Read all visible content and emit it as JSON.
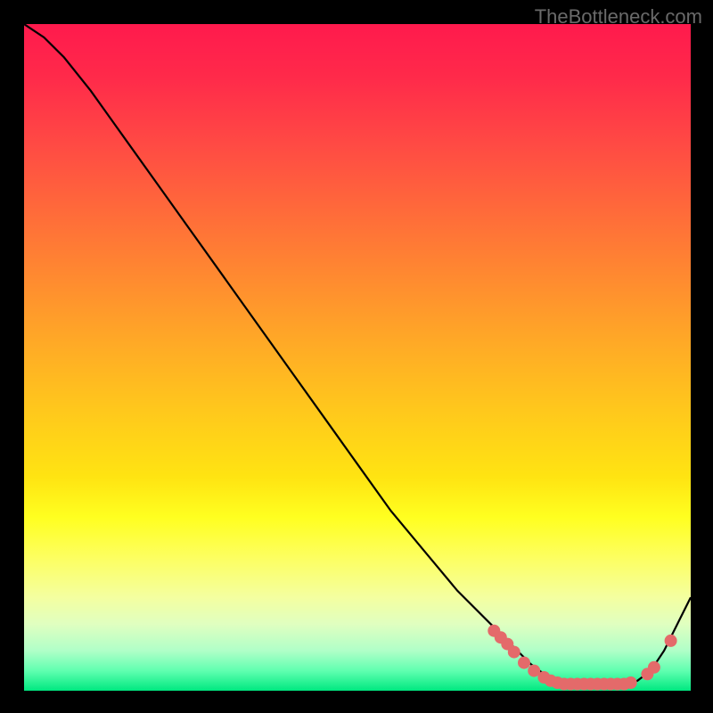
{
  "attribution": "TheBottleneck.com",
  "chart_data": {
    "type": "line",
    "title": "",
    "xlabel": "",
    "ylabel": "",
    "xlim": [
      0,
      100
    ],
    "ylim": [
      0,
      100
    ],
    "series": [
      {
        "name": "bottleneck-curve",
        "x": [
          0,
          3,
          6,
          10,
          15,
          20,
          25,
          30,
          35,
          40,
          45,
          50,
          55,
          60,
          65,
          70,
          72,
          74,
          76,
          78,
          80,
          82,
          84,
          86,
          88,
          90,
          92,
          94,
          96,
          98,
          100
        ],
        "y": [
          100,
          98,
          95,
          90,
          83,
          76,
          69,
          62,
          55,
          48,
          41,
          34,
          27,
          21,
          15,
          10,
          8,
          6,
          4,
          2.5,
          1.5,
          1,
          1,
          1,
          1,
          1,
          1.5,
          3,
          6,
          10,
          14
        ]
      }
    ],
    "markers": {
      "name": "highlight-dots",
      "comment": "Salmon dots clustered near the valley of the curve",
      "points": [
        {
          "x": 70.5,
          "y": 9
        },
        {
          "x": 71.5,
          "y": 8
        },
        {
          "x": 72.5,
          "y": 7
        },
        {
          "x": 73.5,
          "y": 5.8
        },
        {
          "x": 75,
          "y": 4.2
        },
        {
          "x": 76.5,
          "y": 3
        },
        {
          "x": 78,
          "y": 2
        },
        {
          "x": 79,
          "y": 1.5
        },
        {
          "x": 80,
          "y": 1.2
        },
        {
          "x": 81,
          "y": 1
        },
        {
          "x": 82,
          "y": 1
        },
        {
          "x": 83,
          "y": 1
        },
        {
          "x": 84,
          "y": 1
        },
        {
          "x": 85,
          "y": 1
        },
        {
          "x": 86,
          "y": 1
        },
        {
          "x": 87,
          "y": 1
        },
        {
          "x": 88,
          "y": 1
        },
        {
          "x": 89,
          "y": 1
        },
        {
          "x": 90,
          "y": 1
        },
        {
          "x": 91,
          "y": 1.2
        },
        {
          "x": 93.5,
          "y": 2.5
        },
        {
          "x": 94.5,
          "y": 3.5
        },
        {
          "x": 97,
          "y": 7.5
        }
      ],
      "color": "#e46a6a",
      "radius": 7
    },
    "gradient_stops": [
      {
        "pos": 0,
        "color": "#ff1a4d"
      },
      {
        "pos": 50,
        "color": "#ffb820"
      },
      {
        "pos": 75,
        "color": "#ffff20"
      },
      {
        "pos": 100,
        "color": "#00e880"
      }
    ]
  }
}
